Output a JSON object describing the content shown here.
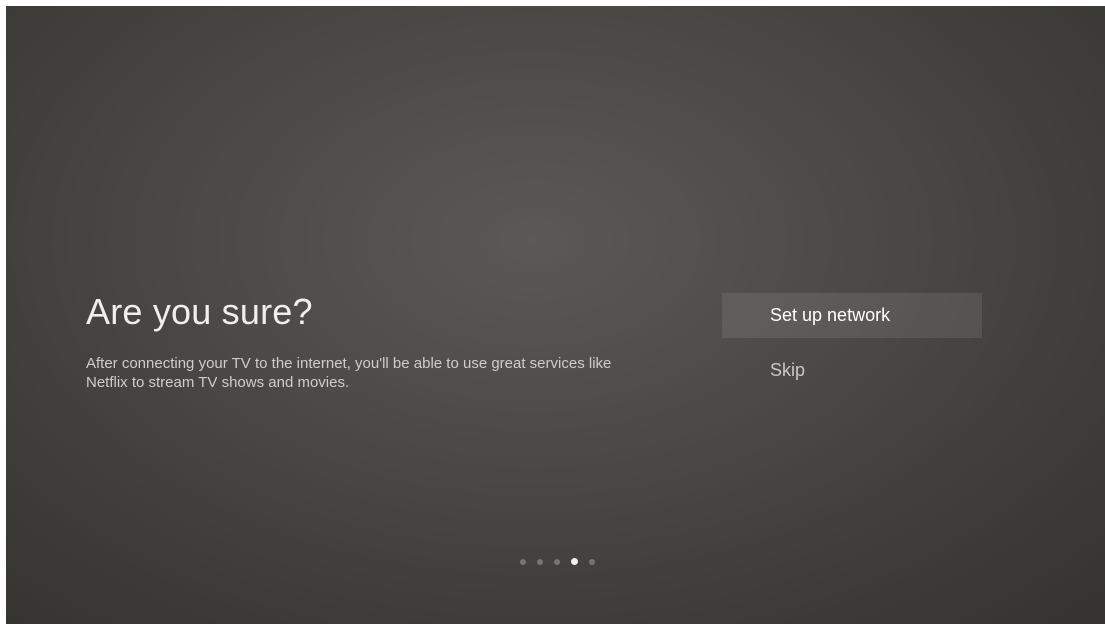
{
  "dialog": {
    "title": "Are you sure?",
    "description": "After connecting your TV to the internet, you'll be able to use great services like Netflix to stream TV shows and movies."
  },
  "menu": {
    "items": [
      {
        "label": "Set up network",
        "focused": true
      },
      {
        "label": "Skip",
        "focused": false
      }
    ]
  },
  "pager": {
    "total_steps": 5,
    "current_step": 4
  },
  "colors": {
    "background": "#4a4845",
    "title_text": "#f0efed",
    "body_text": "#cfcdca",
    "focus_highlight": "rgba(255,255,255,0.09)",
    "dot_inactive": "#77756f",
    "dot_active": "#f2f1ef"
  }
}
